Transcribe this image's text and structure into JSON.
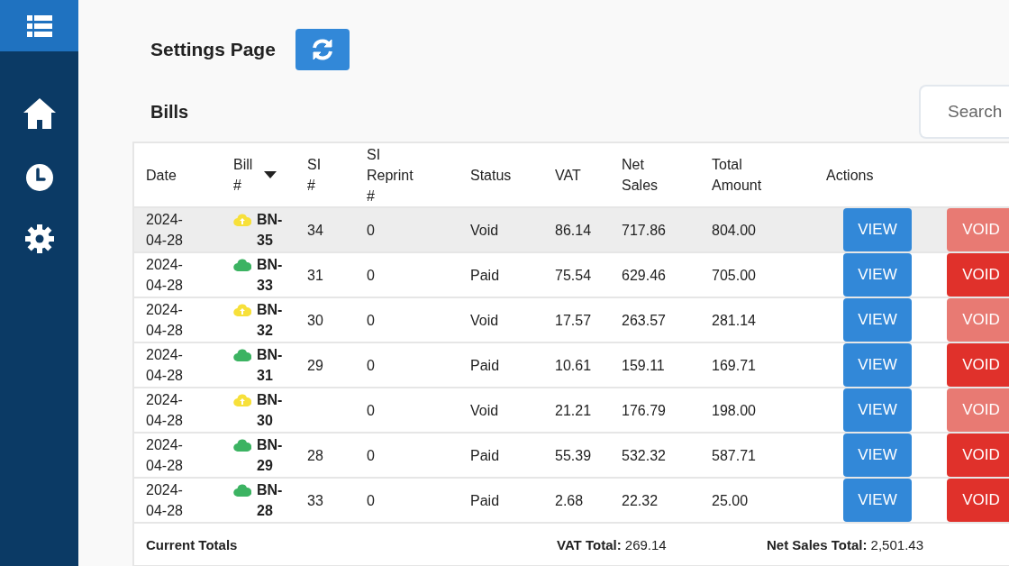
{
  "page": {
    "title": "Settings Page"
  },
  "section": {
    "title": "Bills"
  },
  "search": {
    "placeholder": "Search"
  },
  "table": {
    "columns": [
      {
        "label": "Date"
      },
      {
        "label": "Bill #",
        "sortable": true
      },
      {
        "label": "SI #"
      },
      {
        "label": "SI Reprint #"
      },
      {
        "label": "Status"
      },
      {
        "label": "VAT"
      },
      {
        "label": "Net Sales"
      },
      {
        "label": "Total Amount"
      },
      {
        "label": "Actions"
      }
    ],
    "rows": [
      {
        "date": "2024-04-28",
        "synced": false,
        "bill": "BN-35",
        "si": "34",
        "reprint": "0",
        "status": "Void",
        "vat": "86.14",
        "net": "717.86",
        "total": "804.00",
        "view": "VIEW",
        "void": "VOID",
        "void_disabled": true,
        "selected": true
      },
      {
        "date": "2024-04-28",
        "synced": true,
        "bill": "BN-33",
        "si": "31",
        "reprint": "0",
        "status": "Paid",
        "vat": "75.54",
        "net": "629.46",
        "total": "705.00",
        "view": "VIEW",
        "void": "VOID",
        "void_disabled": false,
        "selected": false
      },
      {
        "date": "2024-04-28",
        "synced": false,
        "bill": "BN-32",
        "si": "30",
        "reprint": "0",
        "status": "Void",
        "vat": "17.57",
        "net": "263.57",
        "total": "281.14",
        "view": "VIEW",
        "void": "VOID",
        "void_disabled": true,
        "selected": false
      },
      {
        "date": "2024-04-28",
        "synced": true,
        "bill": "BN-31",
        "si": "29",
        "reprint": "0",
        "status": "Paid",
        "vat": "10.61",
        "net": "159.11",
        "total": "169.71",
        "view": "VIEW",
        "void": "VOID",
        "void_disabled": false,
        "selected": false
      },
      {
        "date": "2024-04-28",
        "synced": false,
        "bill": "BN-30",
        "reprint": "0",
        "status": "Void",
        "vat": "21.21",
        "net": "176.79",
        "total": "198.00",
        "view": "VIEW",
        "void": "VOID",
        "void_disabled": true,
        "selected": false
      },
      {
        "date": "2024-04-28",
        "synced": true,
        "bill": "BN-29",
        "si": "28",
        "reprint": "0",
        "status": "Paid",
        "vat": "55.39",
        "net": "532.32",
        "total": "587.71",
        "view": "VIEW",
        "void": "VOID",
        "void_disabled": false,
        "selected": false
      },
      {
        "date": "2024-04-28",
        "synced": true,
        "bill": "BN-28",
        "si": "33",
        "reprint": "0",
        "status": "Paid",
        "vat": "2.68",
        "net": "22.32",
        "total": "25.00",
        "view": "VIEW",
        "void": "VOID",
        "void_disabled": false,
        "selected": false
      }
    ],
    "totals": {
      "label": "Current Totals",
      "vat_label": "VAT Total:",
      "vat": "269.14",
      "net_label": "Net Sales Total:",
      "net": "2,501.43"
    }
  }
}
